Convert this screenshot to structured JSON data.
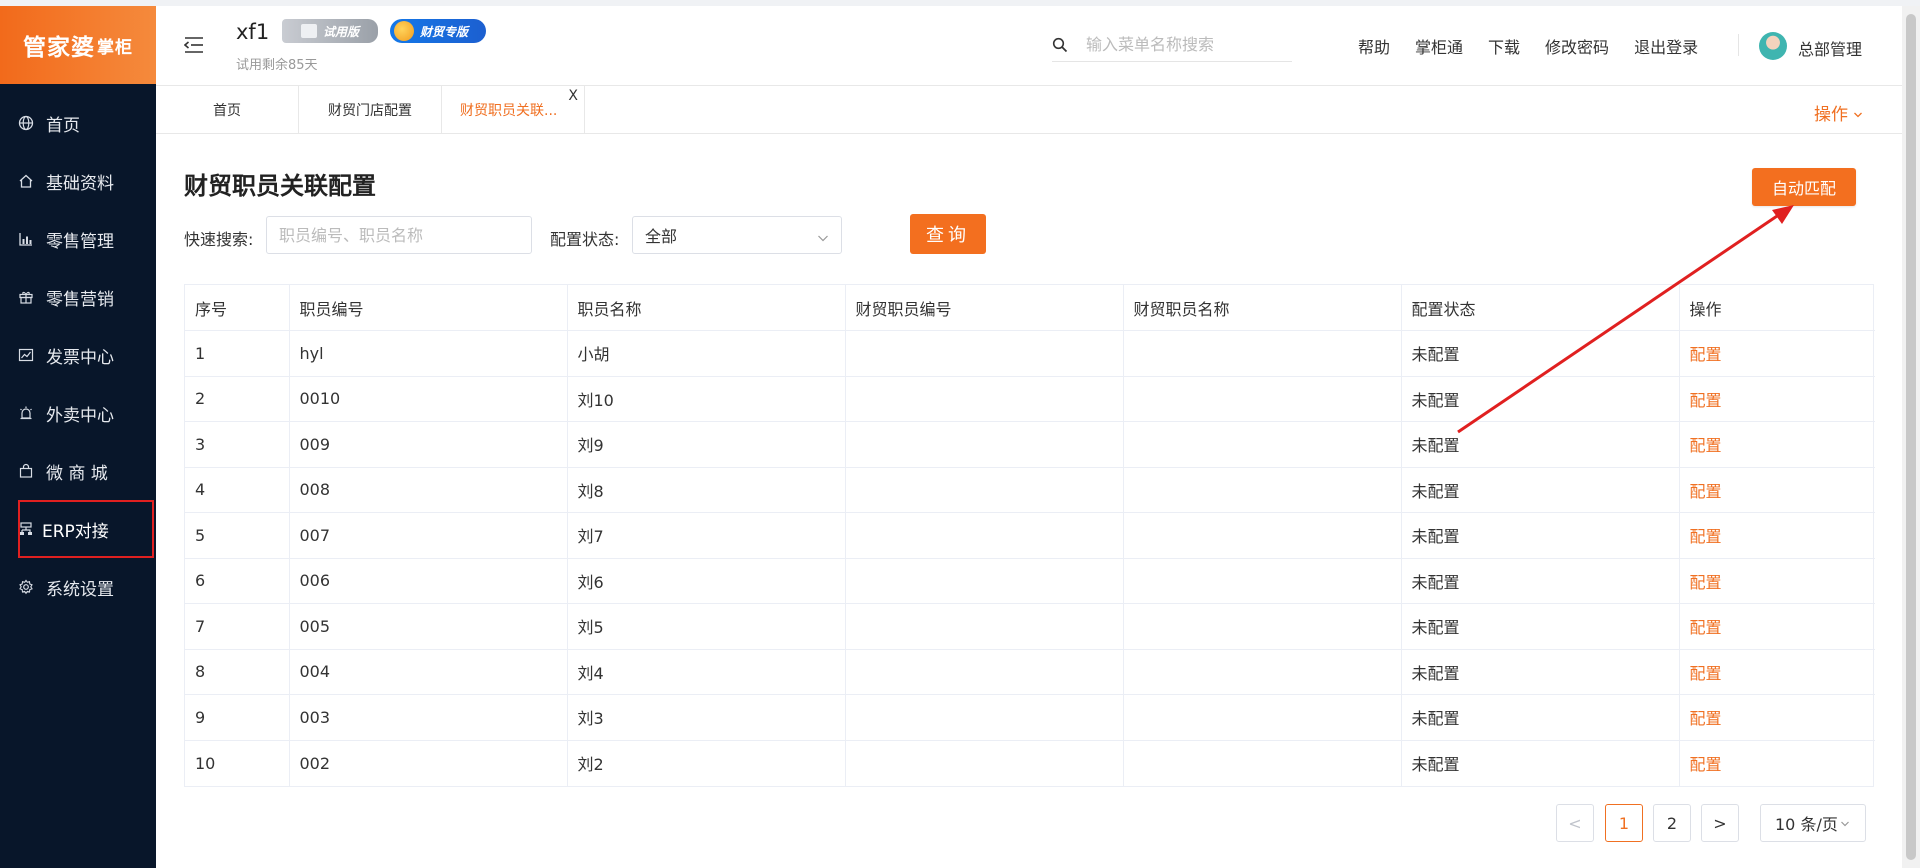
{
  "sidebar": {
    "logo_main": "管家婆",
    "logo_sub": "掌柜",
    "items": [
      {
        "label": "首页"
      },
      {
        "label": "基础资料"
      },
      {
        "label": "零售管理"
      },
      {
        "label": "零售营销"
      },
      {
        "label": "发票中心"
      },
      {
        "label": "外卖中心"
      },
      {
        "label": "微 商 城"
      },
      {
        "label": "ERP对接"
      },
      {
        "label": "系统设置"
      }
    ]
  },
  "header": {
    "company": "xf1",
    "trial_badge": "试用版",
    "finance_badge": "财贸专版",
    "trial_remaining": "试用剩余85天",
    "search_placeholder": "输入菜单名称搜索",
    "links": [
      "帮助",
      "掌柜通",
      "下载",
      "修改密码",
      "退出登录"
    ],
    "user": "总部管理"
  },
  "tabs": {
    "home": "首页",
    "store": "财贸门店配置",
    "active": "财贸职员关联...",
    "close": "X",
    "ops": "操作"
  },
  "page": {
    "title": "财贸职员关联配置",
    "auto_match": "自动匹配",
    "search_label": "快速搜索:",
    "search_placeholder": "职员编号、职员名称",
    "status_label": "配置状态:",
    "status_value": "全部",
    "query": "查询"
  },
  "table": {
    "headers": [
      "序号",
      "职员编号",
      "职员名称",
      "财贸职员编号",
      "财贸职员名称",
      "配置状态",
      "操作"
    ],
    "rows": [
      [
        "1",
        "hyl",
        "小胡",
        "",
        "",
        "未配置",
        "配置"
      ],
      [
        "2",
        "0010",
        "刘10",
        "",
        "",
        "未配置",
        "配置"
      ],
      [
        "3",
        "009",
        "刘9",
        "",
        "",
        "未配置",
        "配置"
      ],
      [
        "4",
        "008",
        "刘8",
        "",
        "",
        "未配置",
        "配置"
      ],
      [
        "5",
        "007",
        "刘7",
        "",
        "",
        "未配置",
        "配置"
      ],
      [
        "6",
        "006",
        "刘6",
        "",
        "",
        "未配置",
        "配置"
      ],
      [
        "7",
        "005",
        "刘5",
        "",
        "",
        "未配置",
        "配置"
      ],
      [
        "8",
        "004",
        "刘4",
        "",
        "",
        "未配置",
        "配置"
      ],
      [
        "9",
        "003",
        "刘3",
        "",
        "",
        "未配置",
        "配置"
      ],
      [
        "10",
        "002",
        "刘2",
        "",
        "",
        "未配置",
        "配置"
      ]
    ]
  },
  "pager": {
    "prev": "<",
    "pages": [
      "1",
      "2"
    ],
    "next": ">",
    "page_size": "10 条/页"
  },
  "colors": {
    "accent": "#f36f1f",
    "sidebar_bg": "#08162a",
    "annotation_red": "#e02020"
  }
}
